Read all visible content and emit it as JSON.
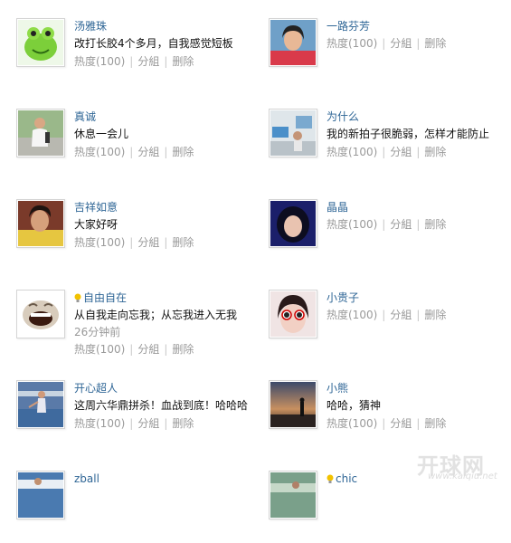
{
  "friends": [
    {
      "name": "汤雅珠",
      "status": "改打长胶4个多月，自我感觉短板",
      "heat": "热度(100)",
      "group": "分組",
      "delete": "删除"
    },
    {
      "name": "一路芬芳",
      "status": "",
      "heat": "热度(100)",
      "group": "分組",
      "delete": "删除"
    },
    {
      "name": "真诚",
      "status": "休息一会儿",
      "heat": "热度(100)",
      "group": "分組",
      "delete": "删除"
    },
    {
      "name": "为什么",
      "status": "我的新拍子很脆弱，怎样才能防止",
      "heat": "热度(100)",
      "group": "分組",
      "delete": "删除"
    },
    {
      "name": "吉祥如意",
      "status": "大家好呀",
      "heat": "热度(100)",
      "group": "分組",
      "delete": "删除"
    },
    {
      "name": "晶晶",
      "status": "",
      "heat": "热度(100)",
      "group": "分組",
      "delete": "删除"
    },
    {
      "name": "自由自在",
      "status": "从自我走向忘我；从忘我进入无我",
      "time": "26分钟前",
      "heat": "热度(100)",
      "group": "分組",
      "delete": "删除"
    },
    {
      "name": "小贵子",
      "status": "",
      "heat": "热度(100)",
      "group": "分組",
      "delete": "删除"
    },
    {
      "name": "开心超人",
      "status": "这周六华鼎拼杀！血战到底！哈哈哈",
      "heat": "热度(100)",
      "group": "分組",
      "delete": "删除"
    },
    {
      "name": "小熊",
      "status": "哈哈，猜神",
      "heat": "热度(100)",
      "group": "分組",
      "delete": "删除"
    },
    {
      "name": "zball",
      "status": "",
      "heat": "",
      "group": "",
      "delete": ""
    },
    {
      "name": "chic",
      "status": "",
      "heat": "",
      "group": "",
      "delete": ""
    }
  ],
  "watermark": {
    "main": "开球网",
    "sub": "www.kaiqiu.net"
  },
  "colors": {
    "name_link": "#2f6696",
    "action_text": "#9a9a9a",
    "status_text": "#111111",
    "bulb": "#f2c200"
  }
}
